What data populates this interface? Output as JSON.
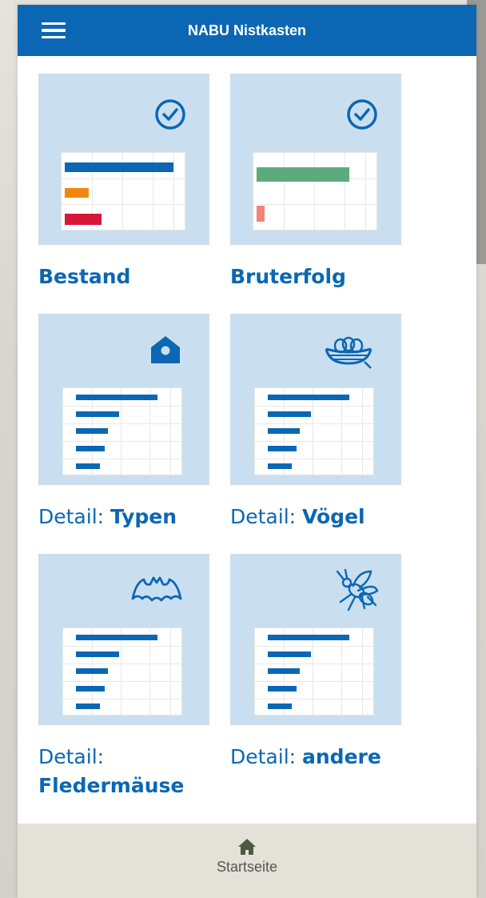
{
  "appbar": {
    "title": "NABU Nistkasten",
    "menu_icon": "hamburger-menu-icon"
  },
  "tiles": [
    {
      "label_pre": "",
      "label_strong": "Bestand",
      "icon": "check-circle-icon"
    },
    {
      "label_pre": "",
      "label_strong": "Bruterfolg",
      "icon": "check-circle-icon"
    },
    {
      "label_pre": "Detail: ",
      "label_strong": "Typen",
      "icon": "house-icon"
    },
    {
      "label_pre": "Detail: ",
      "label_strong": "Vögel",
      "icon": "nest-icon"
    },
    {
      "label_pre": "Detail: ",
      "label_strong": "Fledermäuse",
      "icon": "bat-icon"
    },
    {
      "label_pre": "Detail: ",
      "label_strong": "andere",
      "icon": "insect-icon"
    }
  ],
  "bottom_nav": {
    "home_label": "Startseite",
    "home_icon": "home-icon"
  },
  "colors": {
    "primary": "#0b67b4",
    "tile_bg": "#c9dff0",
    "bar_orange": "#f0870f",
    "bar_red": "#d81638",
    "bar_green": "#5cab7d",
    "bar_salmon": "#f08479",
    "bottom_bar": "#e4e1d8"
  }
}
